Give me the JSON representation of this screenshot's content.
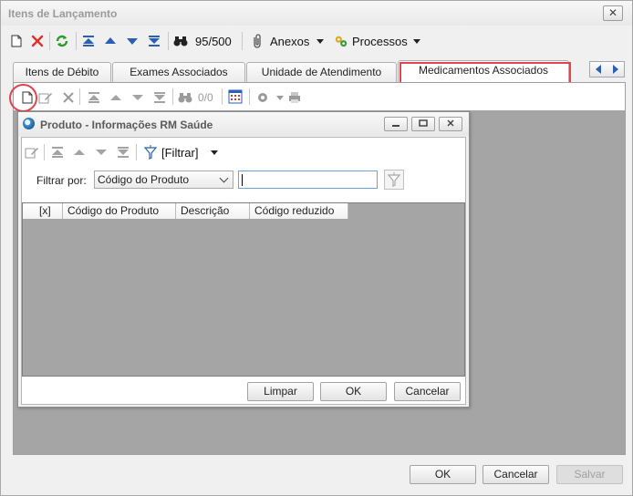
{
  "window": {
    "title": "Itens de Lançamento",
    "close_glyph": "✕"
  },
  "toolbar": {
    "counter": "95/500",
    "anexos_label": "Anexos",
    "processos_label": "Processos",
    "icons": [
      "new-icon",
      "delete-icon",
      "refresh-icon",
      "first-icon",
      "previous-icon",
      "next-icon",
      "last-icon",
      "binoculars-icon",
      "paperclip-icon",
      "gears-icon"
    ]
  },
  "tabs": [
    {
      "label": "Itens de Débito"
    },
    {
      "label": "Exames Associados"
    },
    {
      "label": "Unidade de Atendimento"
    },
    {
      "label": "Medicamentos Associados",
      "active": true
    }
  ],
  "sub_toolbar": {
    "counter": "0/0"
  },
  "dialog": {
    "title": "Produto - Informações RM Saúde",
    "filter_menu_label": "[Filtrar]",
    "filter_by_label": "Filtrar por:",
    "filter_field": {
      "selected": "Código do Produto"
    },
    "search_input": {
      "value": "",
      "placeholder": ""
    },
    "columns": [
      "[x]",
      "Código do Produto",
      "Descrição",
      "Código reduzido"
    ],
    "buttons": {
      "clear": "Limpar",
      "ok": "OK",
      "cancel": "Cancelar"
    }
  },
  "footer": {
    "ok": "OK",
    "cancel": "Cancelar",
    "save": "Salvar"
  },
  "colors": {
    "highlight": "#e0454f",
    "panel_grey": "#a5a5a5",
    "toolbar_blue": "#2b5fb3"
  }
}
